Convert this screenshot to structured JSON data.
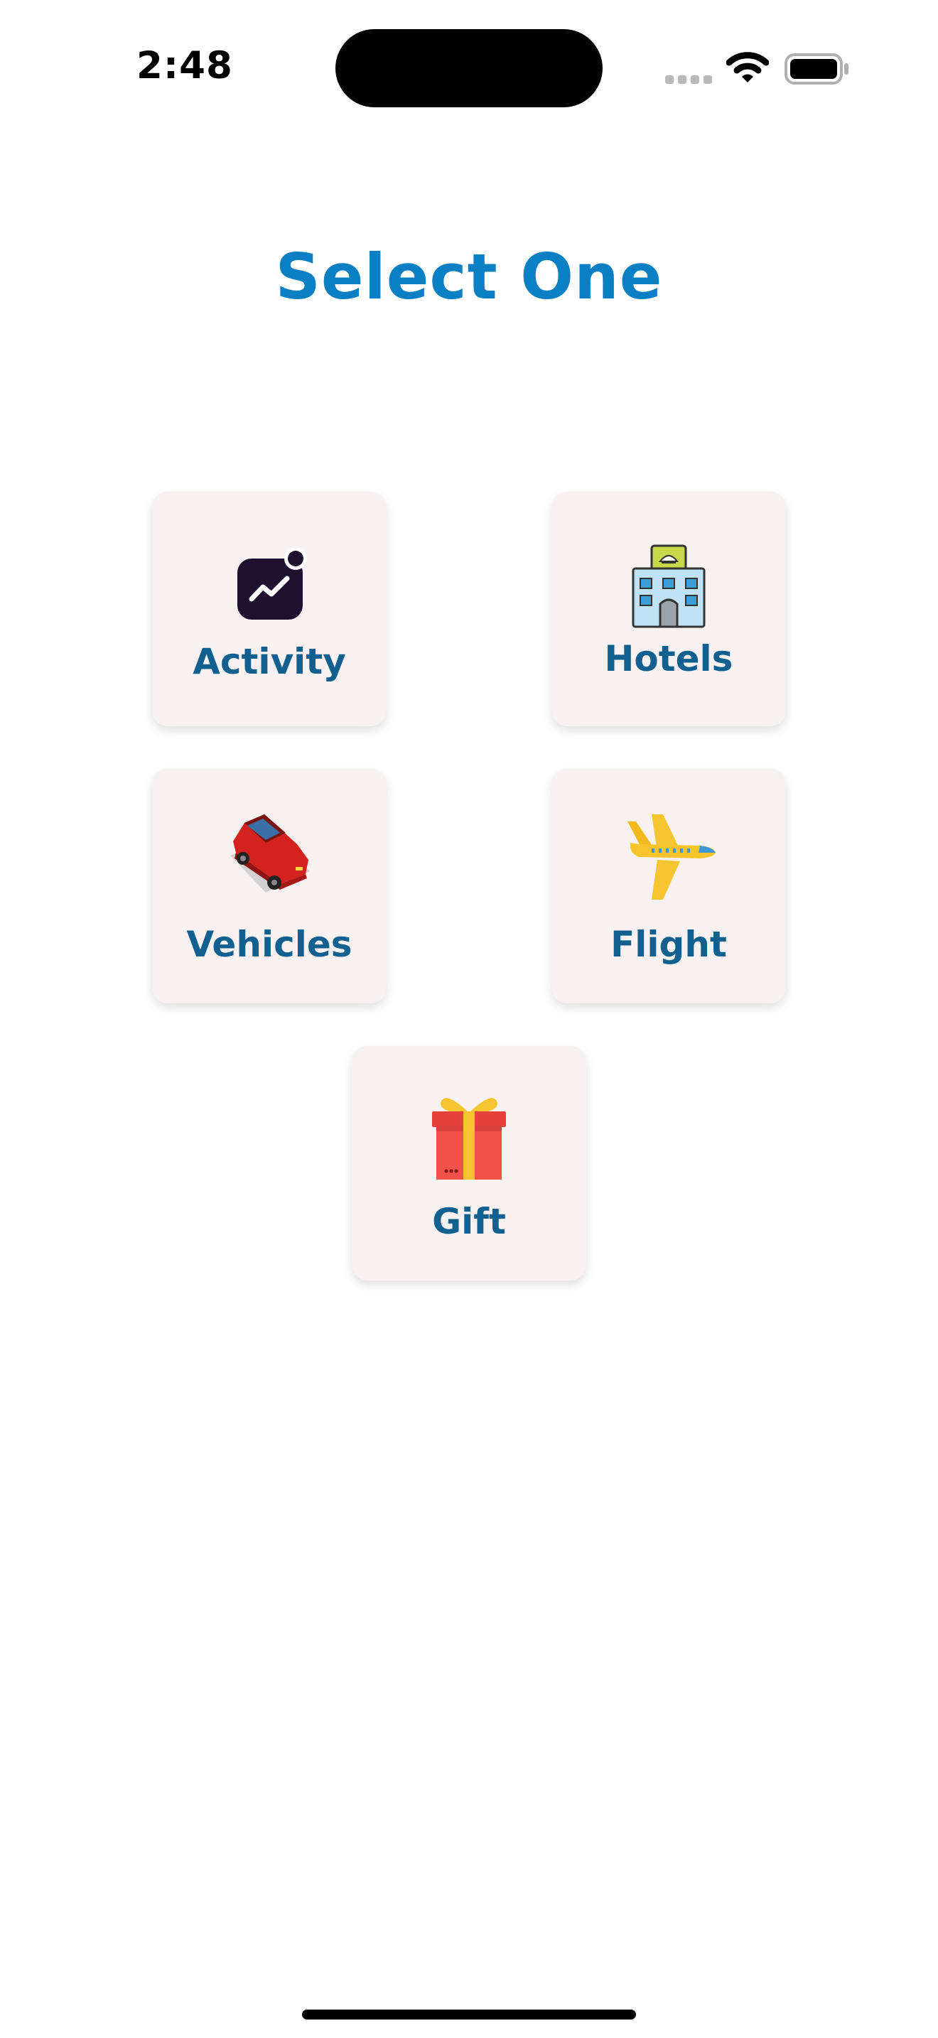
{
  "status_bar": {
    "time": "2:48"
  },
  "header": {
    "title": "Select One"
  },
  "options": [
    {
      "label": "Activity",
      "icon": "activity-chart-icon"
    },
    {
      "label": "Hotels",
      "icon": "hotel-building-icon"
    },
    {
      "label": "Vehicles",
      "icon": "red-car-icon"
    },
    {
      "label": "Flight",
      "icon": "airplane-icon"
    },
    {
      "label": "Gift",
      "icon": "gift-box-icon"
    }
  ],
  "colors": {
    "title": "#0a7fc4",
    "label": "#12608f",
    "card_background": "#f7f1f1"
  }
}
